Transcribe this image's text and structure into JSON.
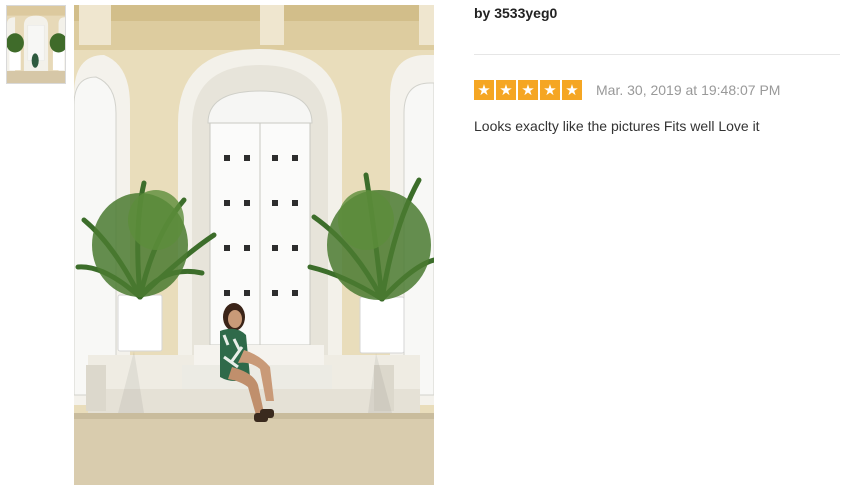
{
  "review": {
    "author": "by 3533yeg0",
    "rating": 5,
    "rating_max": 5,
    "star_color": "#f5a623",
    "date": "Mar. 30, 2019 at 19:48:07 PM",
    "text": "Looks exaclty like the pictures Fits well Love it"
  },
  "photos": {
    "thumbnail_icon": "review-photo-thumbnail",
    "main_icon": "review-photo"
  }
}
